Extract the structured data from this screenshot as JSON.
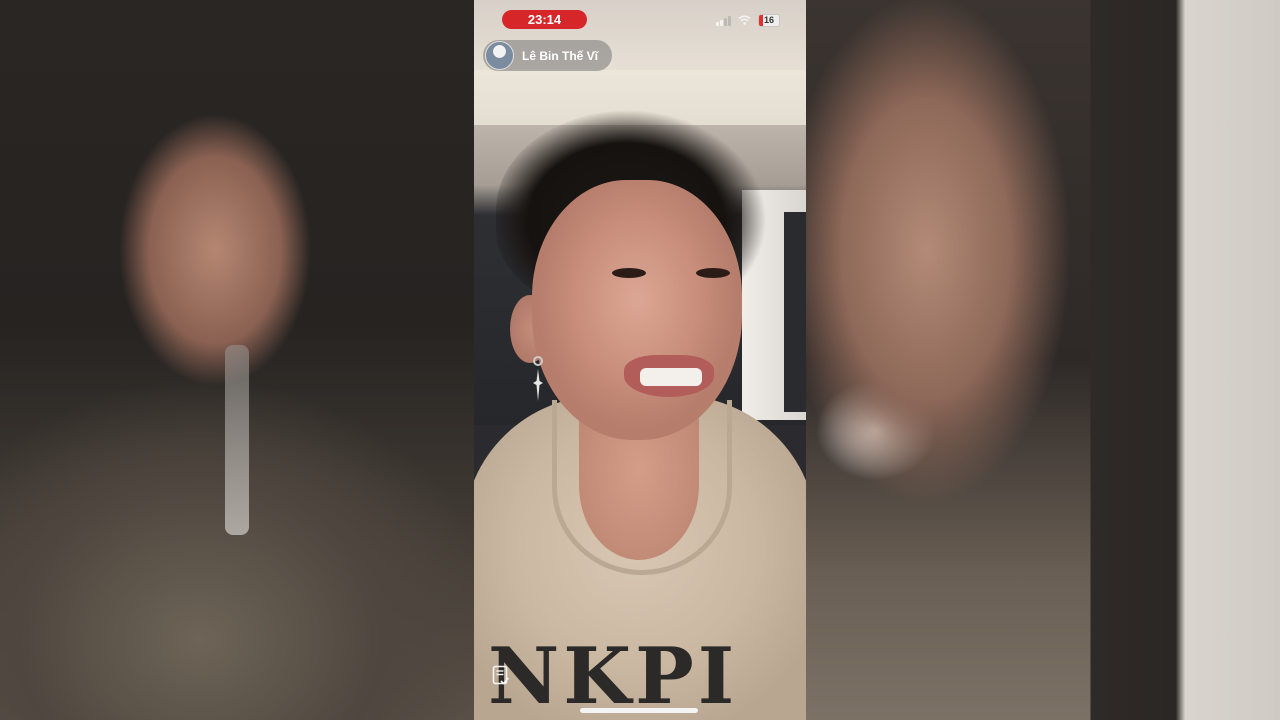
{
  "status_bar": {
    "time": "23:14",
    "battery": "16",
    "accent_color": "#d7262a"
  },
  "host": {
    "name": "Lê Bin Thế Vĩ",
    "avatar_icon": "avatar"
  },
  "shirt_print": "NKPI",
  "icons": [
    "signal-icon",
    "wifi-icon",
    "battery-icon",
    "notes-icon"
  ]
}
